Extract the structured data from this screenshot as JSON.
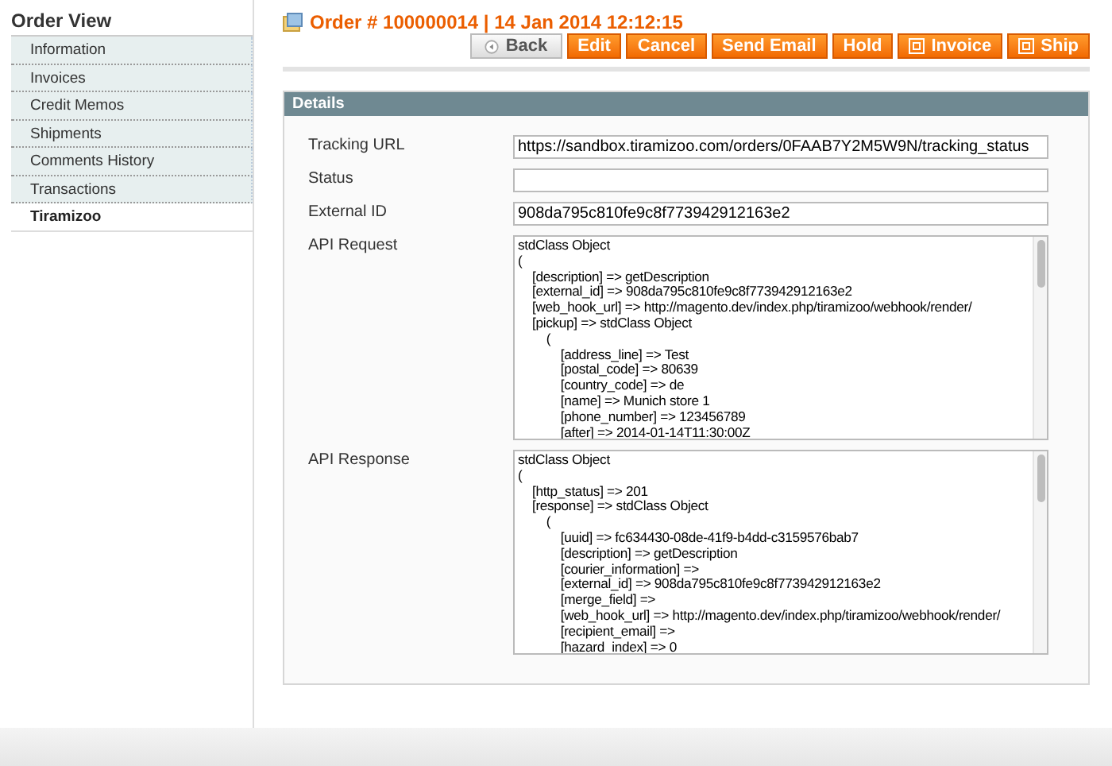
{
  "sidebar": {
    "title": "Order View",
    "items": [
      {
        "label": "Information",
        "selected": false
      },
      {
        "label": "Invoices",
        "selected": false
      },
      {
        "label": "Credit Memos",
        "selected": false
      },
      {
        "label": "Shipments",
        "selected": false
      },
      {
        "label": "Comments History",
        "selected": false
      },
      {
        "label": "Transactions",
        "selected": false
      },
      {
        "label": "Tiramizoo",
        "selected": true
      }
    ]
  },
  "header": {
    "title": "Order # 100000014 | 14 Jan 2014 12:12:15",
    "buttons": [
      {
        "label": "Back",
        "kind": "back"
      },
      {
        "label": "Edit",
        "kind": "plain"
      },
      {
        "label": "Cancel",
        "kind": "plain"
      },
      {
        "label": "Send Email",
        "kind": "plain"
      },
      {
        "label": "Hold",
        "kind": "plain"
      },
      {
        "label": "Invoice",
        "kind": "icon"
      },
      {
        "label": "Ship",
        "kind": "icon"
      }
    ]
  },
  "details": {
    "title": "Details",
    "fields": [
      {
        "label": "Tracking URL",
        "kind": "input",
        "value": "https://sandbox.tiramizoo.com/orders/0FAAB7Y2M5W9N/tracking_status"
      },
      {
        "label": "Status",
        "kind": "input"
      },
      {
        "label": "External ID",
        "kind": "input",
        "value": "908da795c810fe9c8f773942912163e2"
      },
      {
        "label": "API Request",
        "kind": "textarea",
        "lines": [
          "stdClass Object",
          "(",
          "    [description] => getDescription",
          "    [external_id] => 908da795c810fe9c8f773942912163e2",
          "    [web_hook_url] => http://magento.dev/index.php/tiramizoo/webhook/render/",
          "    [pickup] => stdClass Object",
          "        (",
          "            [address_line] => Test",
          "            [postal_code] => 80639",
          "            [country_code] => de",
          "            [name] => Munich store 1",
          "            [phone_number] => 123456789",
          "            [after] => 2014-01-14T11:30:00Z"
        ]
      },
      {
        "label": "API Response",
        "kind": "textarea",
        "lines": [
          "stdClass Object",
          "(",
          "    [http_status] => 201",
          "    [response] => stdClass Object",
          "        (",
          "            [uuid] => fc634430-08de-41f9-b4dd-c3159576bab7",
          "            [description] => getDescription",
          "            [courier_information] =>",
          "            [external_id] => 908da795c810fe9c8f773942912163e2",
          "            [merge_field] =>",
          "            [web_hook_url] => http://magento.dev/index.php/tiramizoo/webhook/render/",
          "            [recipient_email] =>",
          "            [hazard_index] => 0"
        ]
      }
    ]
  }
}
